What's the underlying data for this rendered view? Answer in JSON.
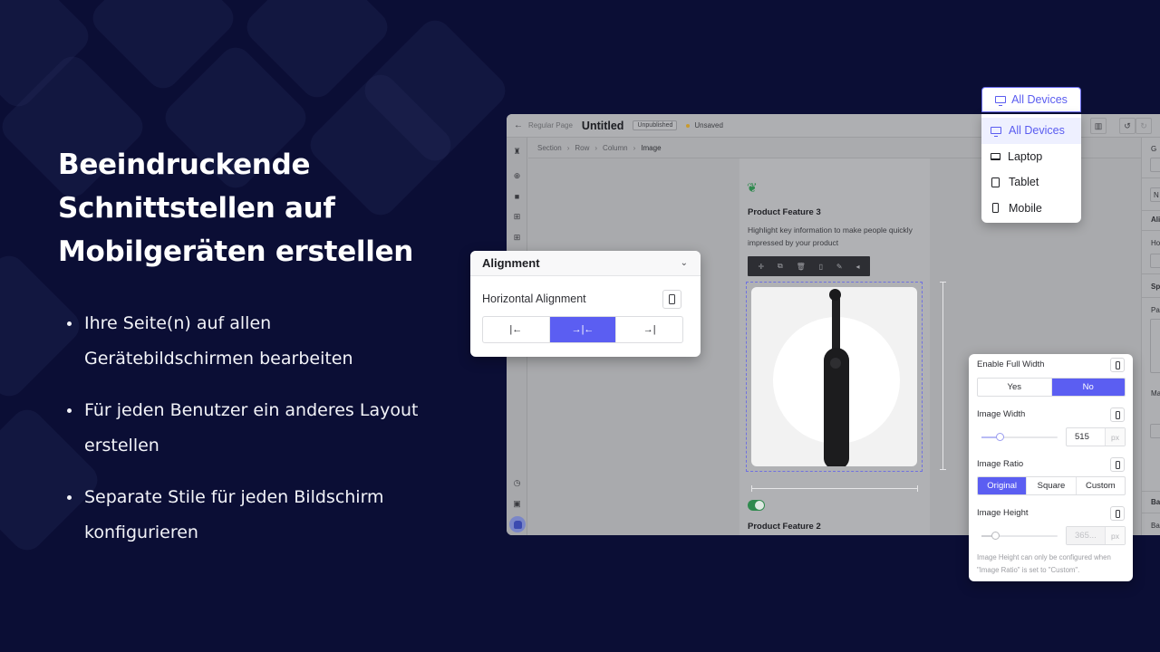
{
  "colors": {
    "background": "#0b0e35",
    "accent": "#5b5ef2",
    "toggle_on": "#2f8a4e",
    "unsaved_dot": "#c99a2e"
  },
  "hero": {
    "title_lines": [
      "Beeindruckende",
      "Schnittstellen auf",
      "Mobilgeräten erstellen"
    ],
    "bullets": [
      {
        "line1": "Ihre Seite(n) auf allen",
        "line2": "Gerätebildschirmen bearbeiten"
      },
      {
        "line1": "Für jeden Benutzer ein anderes Layout",
        "line2": "erstellen"
      },
      {
        "line1": "Separate Stile für jeden Bildschirm",
        "line2": "konfigurieren"
      }
    ]
  },
  "editor": {
    "topbar": {
      "back_icon": "arrow-left-icon",
      "page_type": "Regular Page",
      "title": "Untitled",
      "status_badge": "Unpublished",
      "save_status": "Unsaved",
      "icons": [
        "settings-sliders-icon",
        "undo-icon",
        "redo-icon"
      ]
    },
    "breadcrumb": [
      "Section",
      "Row",
      "Column",
      "Image"
    ],
    "left_rail_icons": [
      "layers-icon",
      "add-icon",
      "shopify-icon",
      "grid-icon",
      "apps-add-icon",
      "history-icon",
      "code-icon",
      "avatar"
    ],
    "canvas": {
      "feature3_title": "Product Feature 3",
      "feature3_desc": "Highlight key information to make people quickly impressed by your product",
      "element_toolbar_icons": [
        "move-icon",
        "duplicate-icon",
        "delete-icon",
        "copy-style-icon",
        "paint-icon",
        "collapse-icon"
      ],
      "toggle_on": true,
      "feature2_title": "Product Feature 2"
    },
    "right_panel_labels": [
      "G",
      "N",
      "Ali",
      "Ho",
      "Sp",
      "Pa",
      "Ma",
      "Ba",
      "Ba"
    ]
  },
  "device_selector": {
    "selected": "All Devices",
    "options": [
      {
        "label": "All Devices",
        "icon": "desktop-icon",
        "active": true
      },
      {
        "label": "Laptop",
        "icon": "laptop-icon",
        "active": false
      },
      {
        "label": "Tablet",
        "icon": "tablet-icon",
        "active": false
      },
      {
        "label": "Mobile",
        "icon": "mobile-icon",
        "active": false
      }
    ]
  },
  "alignment_card": {
    "title": "Alignment",
    "label": "Horizontal Alignment",
    "options": [
      {
        "glyph": "|←",
        "name": "align-left",
        "active": false
      },
      {
        "glyph": "→|←",
        "name": "align-center",
        "active": true
      },
      {
        "glyph": "→|",
        "name": "align-right",
        "active": false
      }
    ]
  },
  "image_card": {
    "full_width": {
      "label": "Enable Full Width",
      "options": [
        "Yes",
        "No"
      ],
      "selected": "No"
    },
    "image_width": {
      "label": "Image Width",
      "value": "515",
      "unit": "px",
      "slider_fraction": 0.24
    },
    "image_ratio": {
      "label": "Image Ratio",
      "options": [
        "Original",
        "Square",
        "Custom"
      ],
      "selected": "Original"
    },
    "image_height": {
      "label": "Image Height",
      "value": "365...",
      "unit": "px",
      "slider_fraction": 0.18,
      "disabled": true
    },
    "note": "Image Height can only be configured when \"Image Ratio\" is set to \"Custom\"."
  }
}
